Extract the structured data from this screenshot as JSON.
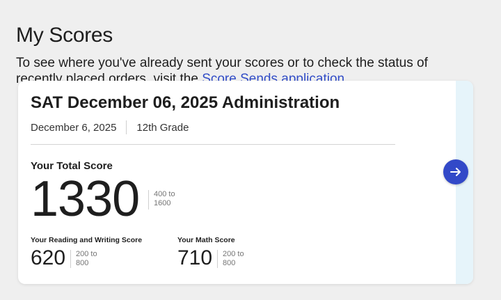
{
  "page": {
    "title": "My Scores",
    "intro_text": "To see where you've already sent your scores or to check the status of recently placed orders, visit the ",
    "intro_link": "Score Sends application",
    "intro_end": "."
  },
  "card": {
    "title": "SAT December 06, 2025 Administration",
    "date": "December 6, 2025",
    "grade": "12th Grade",
    "total_label": "Your Total Score",
    "total_score": "1330",
    "total_range_low": "400 to",
    "total_range_high": "1600",
    "rw_label": "Your Reading and Writing Score",
    "rw_score": "620",
    "rw_range_low": "200 to",
    "rw_range_high": "800",
    "math_label": "Your Math Score",
    "math_score": "710",
    "math_range_low": "200 to",
    "math_range_high": "800"
  },
  "icons": {
    "next": "arrow-right-icon"
  },
  "colors": {
    "accent": "#3249c8",
    "link": "#324dc7",
    "side_panel": "#e6f4fa"
  }
}
